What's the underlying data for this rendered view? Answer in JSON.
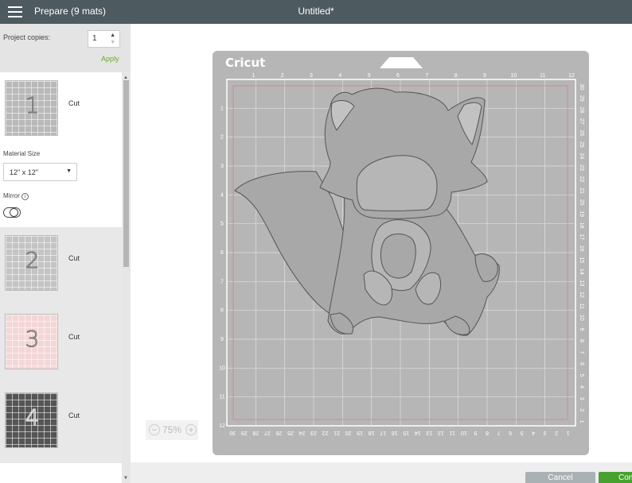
{
  "header": {
    "menu_icon": "hamburger-menu-icon",
    "title": "Prepare (9 mats)",
    "document_title": "Untitled*"
  },
  "left_panel": {
    "project_copies_label": "Project copies:",
    "project_copies_value": "1",
    "apply_label": "Apply",
    "material_size_label": "Material Size",
    "material_size_value": "12\" x 12\"",
    "mirror_label": "Mirror",
    "mirror_enabled": false,
    "mats": [
      {
        "number": "1",
        "label": "Cut",
        "active": true,
        "color": "#b9b9b9"
      },
      {
        "number": "2",
        "label": "Cut",
        "active": false,
        "color": "#c4c4c4"
      },
      {
        "number": "3",
        "label": "Cut",
        "active": false,
        "color": "#f3d6d6"
      },
      {
        "number": "4",
        "label": "Cut",
        "active": false,
        "color": "#555555"
      }
    ]
  },
  "canvas": {
    "brand": "Cricut",
    "zoom_label": "75%",
    "top_ruler": [
      "1",
      "2",
      "3",
      "4",
      "5",
      "6",
      "7",
      "8",
      "9",
      "10",
      "11",
      "12"
    ],
    "left_ruler": [
      "1",
      "2",
      "3",
      "4",
      "5",
      "6",
      "7",
      "8",
      "9",
      "10",
      "11",
      "12"
    ],
    "right_ruler": [
      "30",
      "29",
      "28",
      "27",
      "26",
      "25",
      "24",
      "23",
      "22",
      "21",
      "20",
      "19",
      "18",
      "17",
      "16",
      "15",
      "14",
      "13",
      "12",
      "11",
      "10",
      "9",
      "8",
      "7",
      "6",
      "5",
      "4",
      "3",
      "2",
      "1"
    ],
    "bottom_ruler": [
      "30",
      "29",
      "28",
      "27",
      "26",
      "25",
      "24",
      "23",
      "22",
      "21",
      "20",
      "19",
      "18",
      "17",
      "16",
      "15",
      "14",
      "13",
      "12",
      "11",
      "10",
      "9",
      "8",
      "7",
      "6",
      "5",
      "4",
      "3",
      "2",
      "1"
    ]
  },
  "footer": {
    "cancel_label": "Cancel",
    "continue_label": "Con"
  },
  "colors": {
    "header_bg": "#4d5a5f",
    "accent_green": "#6bab2e",
    "mat_gray": "#b6b6b6",
    "cut_line": "#d98080"
  }
}
